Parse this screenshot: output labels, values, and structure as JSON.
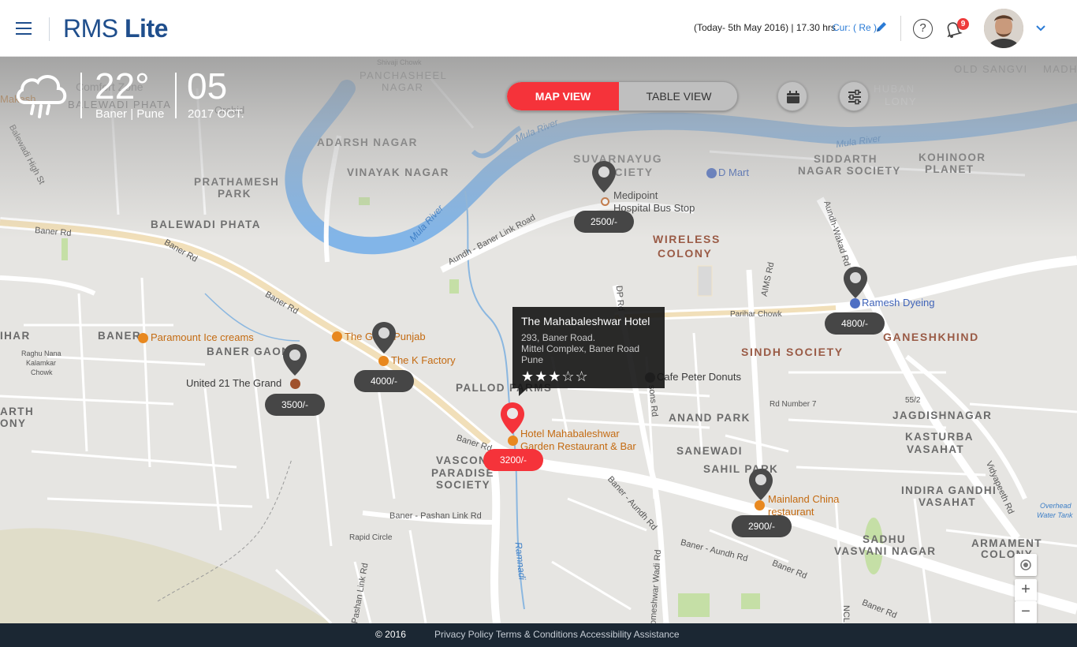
{
  "header": {
    "logo_light": "RMS",
    "logo_bold": "Lite",
    "date_text": "(Today- 5th May 2016) | 17.30 hrs",
    "currency_text": "Cur: ( Re )",
    "notification_count": "9",
    "help_glyph": "?"
  },
  "weather": {
    "icon": "rain-cloud-icon",
    "temperature": "22°",
    "location": "Baner | Pune",
    "day": "05",
    "month_year": "2017 OCT."
  },
  "view_toggle": {
    "map_label": "MAP VIEW",
    "table_label": "TABLE VIEW",
    "active": "MAP VIEW",
    "active_color": "#f5333a"
  },
  "tools": [
    {
      "name": "calendar-icon"
    },
    {
      "name": "sliders-icon"
    }
  ],
  "map": {
    "areas": [
      {
        "text": "PANCHASHEEL"
      },
      {
        "text": "NAGAR"
      },
      {
        "text": "BALEWADI PHATA"
      },
      {
        "text": "ADARSH NAGAR"
      },
      {
        "text": "VINAYAK NAGAR"
      },
      {
        "text": "PRATHAMESH"
      },
      {
        "text": "PARK"
      },
      {
        "text": "BALEWADI PHATA"
      },
      {
        "text": "SUVARNAYUG"
      },
      {
        "text": "SOCIETY"
      },
      {
        "text": "SIDDARTH"
      },
      {
        "text": "NAGAR SOCIETY"
      },
      {
        "text": "KOHINOOR"
      },
      {
        "text": "PLANET"
      },
      {
        "text": "WIRELESS"
      },
      {
        "text": "COLONY"
      },
      {
        "text": "SINDH SOCIETY"
      },
      {
        "text": "GANESHKHIND"
      },
      {
        "text": "BANER"
      },
      {
        "text": "BANER GAON"
      },
      {
        "text": "PALLOD FARMS"
      },
      {
        "text": "ANAND PARK"
      },
      {
        "text": "JAGDISHNAGAR"
      },
      {
        "text": "KASTURBA"
      },
      {
        "text": "VASAHAT"
      },
      {
        "text": "SANEWADI"
      },
      {
        "text": "SAHIL PARK"
      },
      {
        "text": "VASCON"
      },
      {
        "text": "PARADISE"
      },
      {
        "text": "SOCIETY"
      },
      {
        "text": "INDIRA GANDHI"
      },
      {
        "text": "VASAHAT"
      },
      {
        "text": "SADHU"
      },
      {
        "text": "VASVANI NAGAR"
      },
      {
        "text": "ARMAMENT"
      },
      {
        "text": "COLONY"
      },
      {
        "text": "OLD SANGVI"
      },
      {
        "text": "HUBAN"
      },
      {
        "text": "LONY"
      },
      {
        "text": "IHAR"
      },
      {
        "text": "ARTH"
      },
      {
        "text": "ONY"
      },
      {
        "text": "MADH"
      }
    ],
    "roads": [
      {
        "text": "Baner Rd"
      },
      {
        "text": "Baner Rd"
      },
      {
        "text": "Baner Rd"
      },
      {
        "text": "Balewadi High St"
      },
      {
        "text": "Aundh - Baner Link Road"
      },
      {
        "text": "Aundh-Wakad Rd"
      },
      {
        "text": "AIMS Rd"
      },
      {
        "text": "DP Rd"
      },
      {
        "text": "Parihar Chowk"
      },
      {
        "text": "Rd Number 7"
      },
      {
        "text": "55/2"
      },
      {
        "text": "Baner - Aundh Rd"
      },
      {
        "text": "Baner - Aundh Rd"
      },
      {
        "text": "Baner Rd"
      },
      {
        "text": "Baner Rd"
      },
      {
        "text": "Baner Rd"
      },
      {
        "text": "Baner - Pashan Link Rd"
      },
      {
        "text": "Rapid Circle"
      },
      {
        "text": "Vidyapeeth Rd"
      },
      {
        "text": "Shivaji Chowk"
      },
      {
        "text": "Raghu Nana"
      },
      {
        "text": "Kalamkar"
      },
      {
        "text": "Chowk"
      },
      {
        "text": "Pashan Link Rd"
      },
      {
        "text": "Someshwar Wadi Rd"
      },
      {
        "text": "NCL"
      },
      {
        "text": "sons Rd"
      }
    ],
    "water": [
      {
        "text": "Mula River"
      },
      {
        "text": "Mula River"
      },
      {
        "text": "Mula River"
      },
      {
        "text": "Ramnadi"
      },
      {
        "text": "Overhead"
      },
      {
        "text": "Water Tank"
      }
    ],
    "pois": [
      {
        "text": "Comfort Zone"
      },
      {
        "text": "Orchid"
      },
      {
        "text": "Makesh"
      },
      {
        "text": "Medipoint"
      },
      {
        "text": "Hospital Bus Stop"
      },
      {
        "text": "D Mart"
      },
      {
        "text": "Ramesh Dyeing"
      },
      {
        "text": "Paramount Ice creams"
      },
      {
        "text": "The Great Punjab"
      },
      {
        "text": "The K Factory"
      },
      {
        "text": "United 21 The Grand"
      },
      {
        "text": "Cafe Peter Donuts"
      },
      {
        "text": "Hotel Mahabaleshwar"
      },
      {
        "text": "Garden Restaurant & Bar"
      },
      {
        "text": "Mainland China"
      },
      {
        "text": "restaurant"
      }
    ]
  },
  "markers": [
    {
      "price": "2500/-",
      "active": false
    },
    {
      "price": "4800/-",
      "active": false
    },
    {
      "price": "4000/-",
      "active": false
    },
    {
      "price": "3500/-",
      "active": false
    },
    {
      "price": "3200/-",
      "active": true
    },
    {
      "price": "2900/-",
      "active": false
    }
  ],
  "tooltip": {
    "title": "The Mahabaleshwar Hotel",
    "address1": "293, Baner Road.",
    "address2": "Mittel Complex, Baner Road",
    "address3": "Pune",
    "rating": 3,
    "max_rating": 5,
    "stars": "★★★☆☆"
  },
  "map_controls": {
    "locate": "locate-icon",
    "zoom_in": "+",
    "zoom_out": "−"
  },
  "footer": {
    "copyright": "© 2016",
    "links": [
      "Privacy Policy",
      "Terms & Conditions",
      "Accessibility",
      "Assistance"
    ]
  }
}
